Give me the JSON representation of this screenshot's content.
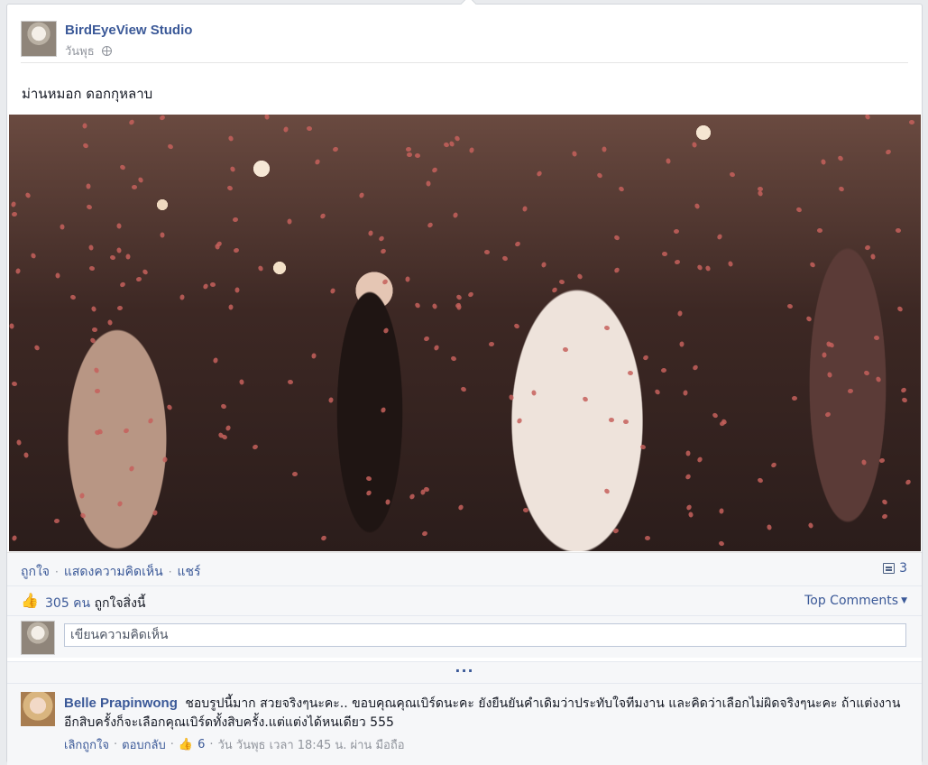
{
  "post": {
    "page_name": "BirdEyeView Studio",
    "time": "วันพุธ",
    "caption": "ม่านหมอก ดอกกุหลาบ"
  },
  "actions": {
    "like": "ถูกใจ",
    "comment": "แสดงความคิดเห็น",
    "share": "แชร์",
    "comment_count": "3"
  },
  "likes": {
    "count": "305 คน",
    "suffix": "ถูกใจสิ่งนี้",
    "sort_label": "Top Comments"
  },
  "compose": {
    "placeholder": "เขียนความคิดเห็น"
  },
  "more": "···",
  "comments": [
    {
      "author": "Belle Prapinwong",
      "text": "ชอบรูปนี้มาก สวยจริงๆนะคะ.. ขอบคุณคุณเบิร์ดนะคะ ยังยืนยันคำเดิมว่าประทับใจทีมงาน และคิดว่าเลือกไม่ผิดจริงๆนะคะ ถ้าแต่งงานอีกสิบครั้งก็จะเลือกคุณเบิร์ดทั้งสิบครั้ง.แต่แต่งได้หนเดียว 555",
      "unlike": "เลิกถูกใจ",
      "reply": "ตอบกลับ",
      "like_count": "6",
      "timestamp": "วัน วันพุธ เวลา 18:45 น. ผ่าน มือถือ"
    }
  ],
  "colors": {
    "link": "#3b5998",
    "muted": "#90949c",
    "bar_bg": "#f6f7f9"
  }
}
